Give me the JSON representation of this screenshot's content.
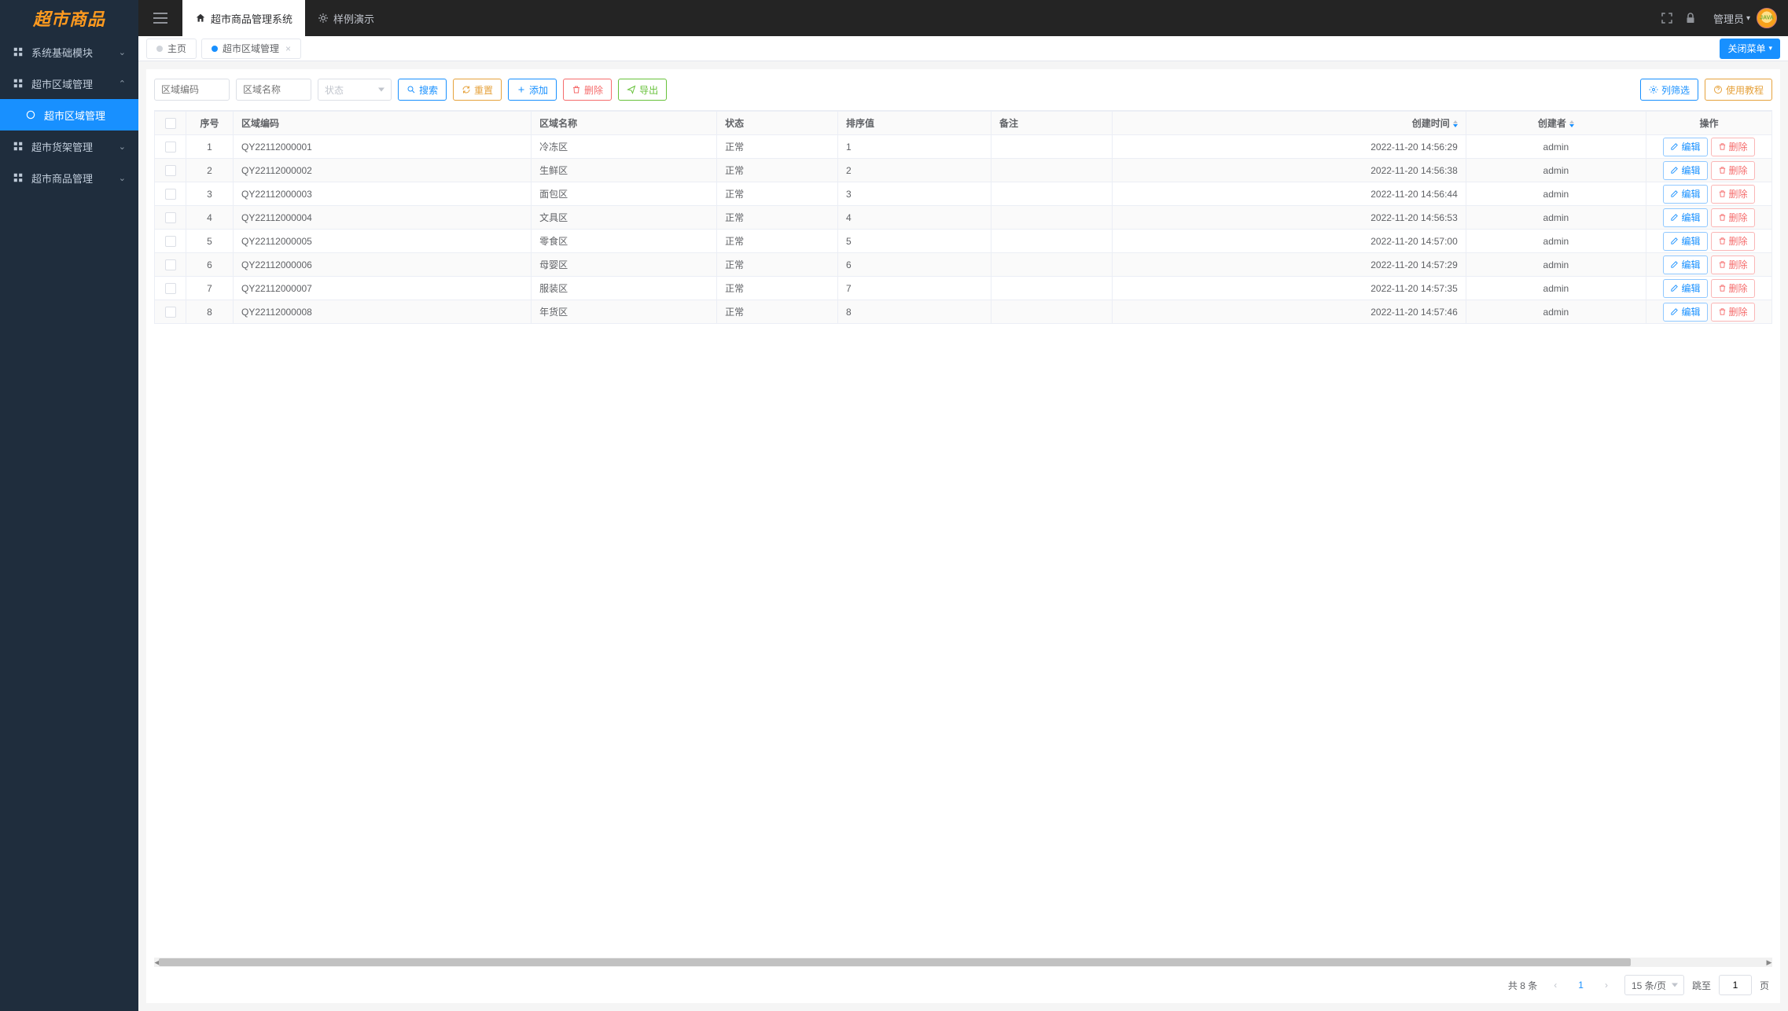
{
  "logo": "超市商品",
  "sidebar": {
    "items": [
      {
        "label": "系统基础模块",
        "expanded": false
      },
      {
        "label": "超市区域管理",
        "expanded": true,
        "children": [
          {
            "label": "超市区域管理",
            "active": true
          }
        ]
      },
      {
        "label": "超市货架管理",
        "expanded": false
      },
      {
        "label": "超市商品管理",
        "expanded": false
      }
    ]
  },
  "topbar": {
    "tabs": [
      {
        "label": "超市商品管理系统",
        "active": true
      },
      {
        "label": "样例演示",
        "active": false
      }
    ],
    "user_label": "管理员"
  },
  "page_tabs": {
    "items": [
      {
        "label": "主页",
        "active": false,
        "closable": false
      },
      {
        "label": "超市区域管理",
        "active": true,
        "closable": true
      }
    ],
    "close_menu_label": "关闭菜单"
  },
  "filters": {
    "code_placeholder": "区域编码",
    "name_placeholder": "区域名称",
    "status_placeholder": "状态"
  },
  "actions": {
    "search": "搜索",
    "reset": "重置",
    "add": "添加",
    "delete": "删除",
    "export": "导出",
    "column_filter": "列筛选",
    "tutorial": "使用教程"
  },
  "table": {
    "headers": {
      "seq": "序号",
      "code": "区域编码",
      "name": "区域名称",
      "status": "状态",
      "sort": "排序值",
      "remark": "备注",
      "create_time": "创建时间",
      "creator": "创建者",
      "op": "操作"
    },
    "op_edit": "编辑",
    "op_delete": "删除",
    "rows": [
      {
        "seq": "1",
        "code": "QY22112000001",
        "name": "冷冻区",
        "status": "正常",
        "sort": "1",
        "remark": "",
        "create_time": "2022-11-20 14:56:29",
        "creator": "admin"
      },
      {
        "seq": "2",
        "code": "QY22112000002",
        "name": "生鲜区",
        "status": "正常",
        "sort": "2",
        "remark": "",
        "create_time": "2022-11-20 14:56:38",
        "creator": "admin"
      },
      {
        "seq": "3",
        "code": "QY22112000003",
        "name": "面包区",
        "status": "正常",
        "sort": "3",
        "remark": "",
        "create_time": "2022-11-20 14:56:44",
        "creator": "admin"
      },
      {
        "seq": "4",
        "code": "QY22112000004",
        "name": "文具区",
        "status": "正常",
        "sort": "4",
        "remark": "",
        "create_time": "2022-11-20 14:56:53",
        "creator": "admin"
      },
      {
        "seq": "5",
        "code": "QY22112000005",
        "name": "零食区",
        "status": "正常",
        "sort": "5",
        "remark": "",
        "create_time": "2022-11-20 14:57:00",
        "creator": "admin"
      },
      {
        "seq": "6",
        "code": "QY22112000006",
        "name": "母婴区",
        "status": "正常",
        "sort": "6",
        "remark": "",
        "create_time": "2022-11-20 14:57:29",
        "creator": "admin"
      },
      {
        "seq": "7",
        "code": "QY22112000007",
        "name": "服装区",
        "status": "正常",
        "sort": "7",
        "remark": "",
        "create_time": "2022-11-20 14:57:35",
        "creator": "admin"
      },
      {
        "seq": "8",
        "code": "QY22112000008",
        "name": "年货区",
        "status": "正常",
        "sort": "8",
        "remark": "",
        "create_time": "2022-11-20 14:57:46",
        "creator": "admin"
      }
    ]
  },
  "pager": {
    "total_text": "共 8 条",
    "current_page": "1",
    "page_size_label": "15 条/页",
    "jump_label": "跳至",
    "jump_value": "1",
    "page_suffix": "页"
  }
}
